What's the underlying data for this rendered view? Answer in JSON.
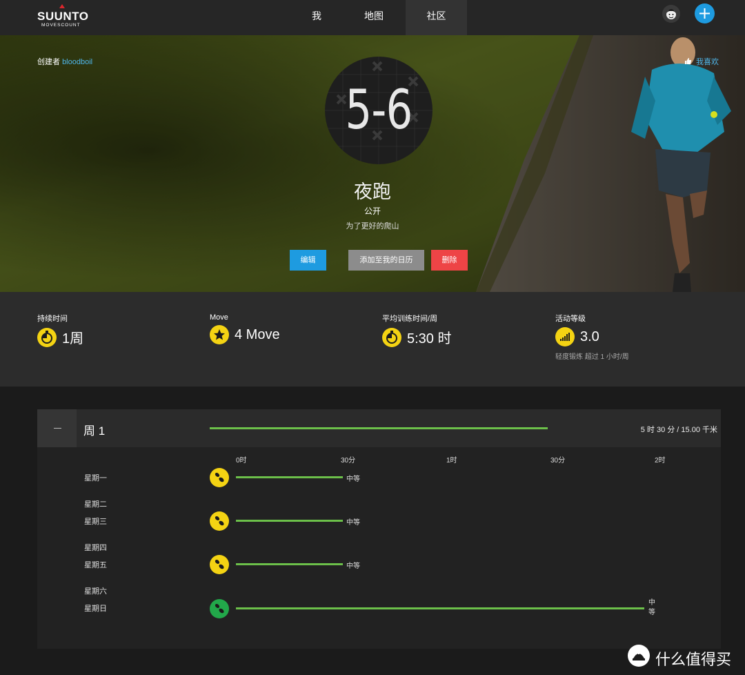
{
  "brand": {
    "name": "SUUNTO",
    "sub": "MOVESCOUNT"
  },
  "nav": {
    "tabs": [
      "我",
      "地图",
      "社区"
    ],
    "active_index": 2
  },
  "hero": {
    "creator_prefix": "创建者",
    "creator_name": "bloodboil",
    "like": "我喜欢",
    "badge": "5-6",
    "title": "夜跑",
    "visibility": "公开",
    "description": "为了更好的爬山",
    "buttons": {
      "edit": "编辑",
      "add_calendar": "添加至我的日历",
      "delete": "删除"
    }
  },
  "stats": [
    {
      "label": "持续时间",
      "value": "1周",
      "icon": "stopwatch-icon"
    },
    {
      "label": "Move",
      "value": "4 Move",
      "icon": "star-icon"
    },
    {
      "label": "平均训练时间/周",
      "value": "5:30 时",
      "icon": "stopwatch-icon"
    },
    {
      "label": "活动等级",
      "value": "3.0",
      "icon": "signal-bars-icon",
      "note": "轻度锻炼 超过 1 小时/周"
    }
  ],
  "week": {
    "title": "周 1",
    "total": "5 时 30 分 / 15.00 千米",
    "progress": 0.65,
    "time_labels": [
      "0时",
      "30分",
      "1时",
      "30分",
      "2时"
    ],
    "days": [
      {
        "name": "星期一",
        "activity": {
          "icon": "shoe-icon",
          "color": "yellow",
          "intensity": "中等",
          "duration_hours": 0.5
        }
      },
      {
        "name": "星期二"
      },
      {
        "name": "星期三",
        "activity": {
          "icon": "shoe-icon",
          "color": "yellow",
          "intensity": "中等",
          "duration_hours": 0.5
        }
      },
      {
        "name": "星期四"
      },
      {
        "name": "星期五",
        "activity": {
          "icon": "shoe-icon",
          "color": "yellow",
          "intensity": "中等",
          "duration_hours": 0.5
        }
      },
      {
        "name": "星期六"
      },
      {
        "name": "星期日",
        "activity": {
          "icon": "shoe-icon",
          "color": "green",
          "intensity": "中等",
          "duration_hours": 2.0
        }
      }
    ]
  },
  "watermark": "什么值得买",
  "colors": {
    "accent_blue": "#1e9be0",
    "yellow": "#f4d313",
    "green": "#6cc04a",
    "red": "#ee4446",
    "gray_button": "#8c8c8c"
  }
}
